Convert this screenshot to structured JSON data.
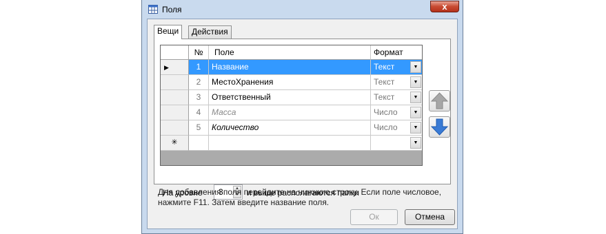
{
  "window": {
    "title": "Поля",
    "close_label": "x"
  },
  "tabs": [
    {
      "label": "Вещи",
      "active": true
    },
    {
      "label": "Действия",
      "active": false
    }
  ],
  "grid": {
    "columns": {
      "num": "№",
      "field": "Поле",
      "format": "Формат"
    },
    "rows": [
      {
        "num": "1",
        "field": "Название",
        "format": "Текст"
      },
      {
        "num": "2",
        "field": "МестоХранения",
        "format": "Текст"
      },
      {
        "num": "3",
        "field": "Ответственный",
        "format": "Текст"
      },
      {
        "num": "4",
        "field": "Масса",
        "format": "Число"
      },
      {
        "num": "5",
        "field": "Количество",
        "format": "Число"
      }
    ],
    "current_row_marker": "▶",
    "new_row_marker": "✳"
  },
  "level": {
    "prefix": "На уровне",
    "value": "3",
    "suffix": "и выше располагаются папки"
  },
  "hint": "Для добавления поля перейдите на нижнюю строку. Если поле числовое, нажмите F11. Затем введите название поля.",
  "buttons": {
    "ok": "Ок",
    "cancel": "Отмена"
  },
  "colors": {
    "selection": "#3399ff",
    "arrow": "#3a7bd5",
    "arrow_disabled": "#a7a7a7"
  }
}
